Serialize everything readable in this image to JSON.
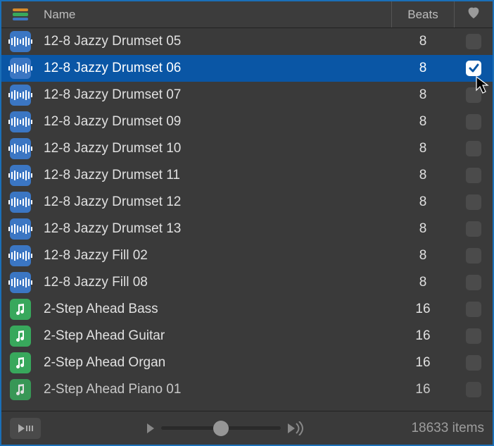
{
  "header": {
    "name_label": "Name",
    "beats_label": "Beats",
    "stack_colors": [
      "#d58b2e",
      "#38a85c",
      "#3b76c3"
    ]
  },
  "rows": [
    {
      "type": "audio",
      "name": "12-8 Jazzy Drumset 05",
      "beats": "8",
      "fav": false,
      "selected": false
    },
    {
      "type": "audio",
      "name": "12-8 Jazzy Drumset 06",
      "beats": "8",
      "fav": true,
      "selected": true
    },
    {
      "type": "audio",
      "name": "12-8 Jazzy Drumset 07",
      "beats": "8",
      "fav": false,
      "selected": false
    },
    {
      "type": "audio",
      "name": "12-8 Jazzy Drumset 09",
      "beats": "8",
      "fav": false,
      "selected": false
    },
    {
      "type": "audio",
      "name": "12-8 Jazzy Drumset 10",
      "beats": "8",
      "fav": false,
      "selected": false
    },
    {
      "type": "audio",
      "name": "12-8 Jazzy Drumset 11",
      "beats": "8",
      "fav": false,
      "selected": false
    },
    {
      "type": "audio",
      "name": "12-8 Jazzy Drumset 12",
      "beats": "8",
      "fav": false,
      "selected": false
    },
    {
      "type": "audio",
      "name": "12-8 Jazzy Drumset 13",
      "beats": "8",
      "fav": false,
      "selected": false
    },
    {
      "type": "audio",
      "name": "12-8 Jazzy Fill 02",
      "beats": "8",
      "fav": false,
      "selected": false
    },
    {
      "type": "audio",
      "name": "12-8 Jazzy Fill 08",
      "beats": "8",
      "fav": false,
      "selected": false
    },
    {
      "type": "software",
      "name": "2-Step Ahead Bass",
      "beats": "16",
      "fav": false,
      "selected": false
    },
    {
      "type": "software",
      "name": "2-Step Ahead Guitar",
      "beats": "16",
      "fav": false,
      "selected": false
    },
    {
      "type": "software",
      "name": "2-Step Ahead Organ",
      "beats": "16",
      "fav": false,
      "selected": false
    },
    {
      "type": "software",
      "name": "2-Step Ahead Piano 01",
      "beats": "16",
      "fav": false,
      "selected": false,
      "partial": true
    }
  ],
  "footer": {
    "items_count": "18633 items"
  }
}
